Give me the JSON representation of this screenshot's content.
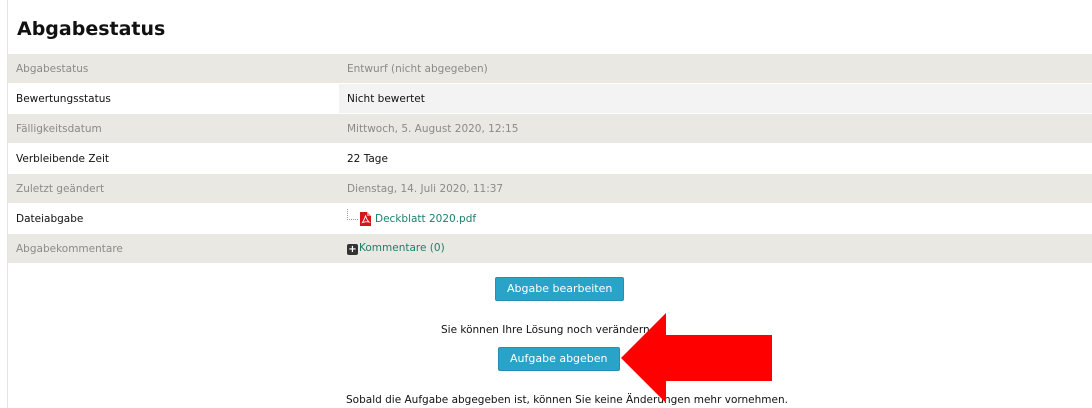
{
  "heading": "Abgabestatus",
  "rows": [
    {
      "label": "Abgabestatus",
      "value": "Entwurf (nicht abgegeben)"
    },
    {
      "label": "Bewertungsstatus",
      "value": "Nicht bewertet"
    },
    {
      "label": "Fälligkeitsdatum",
      "value": "Mittwoch, 5. August 2020, 12:15"
    },
    {
      "label": "Verbleibende Zeit",
      "value": "22 Tage"
    },
    {
      "label": "Zuletzt geändert",
      "value": "Dienstag, 14. Juli 2020, 11:37"
    },
    {
      "label": "Dateiabgabe",
      "value": "Deckblatt 2020.pdf"
    },
    {
      "label": "Abgabekommentare",
      "value": "Kommentare (0)"
    }
  ],
  "buttons": {
    "edit": "Abgabe bearbeiten",
    "submit": "Aufgabe abgeben"
  },
  "notes": {
    "can_change": "Sie können Ihre Lösung noch verändern",
    "after_submit": "Sobald die Aufgabe abgegeben ist, können Sie keine Änderungen mehr vornehmen."
  },
  "colors": {
    "button": "#2aa3c8",
    "link": "#1c7f6e",
    "arrow": "#ff0000"
  },
  "icons": {
    "file": "pdf-icon",
    "comments": "plus-icon",
    "annotation": "red-arrow"
  }
}
